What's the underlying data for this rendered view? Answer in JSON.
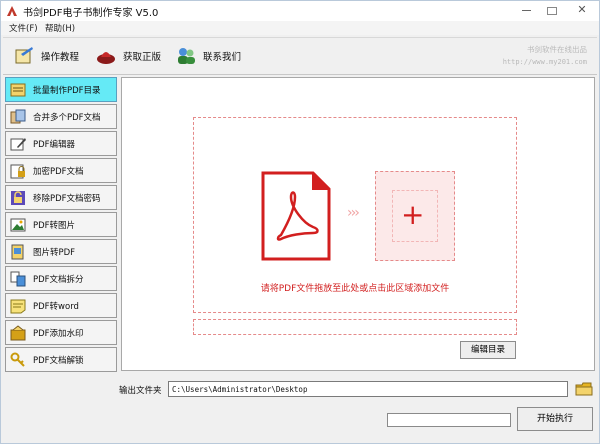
{
  "window": {
    "title": "书剑PDF电子书制作专家 V5.0"
  },
  "menu": {
    "file": "文件(F)",
    "help": "帮助(H)"
  },
  "toolbar": {
    "guide_label": "操作教程",
    "license_label": "获取正版",
    "contact_label": "联系我们",
    "brand_name": "书剑软件在线出品",
    "brand_url": "http://www.my201.com"
  },
  "sidebar": {
    "items": [
      {
        "label": "批量制作PDF目录",
        "icon": "folder-list-icon",
        "active": true
      },
      {
        "label": "合并多个PDF文档",
        "icon": "merge-icon",
        "active": false
      },
      {
        "label": "PDF编辑器",
        "icon": "edit-icon",
        "active": false
      },
      {
        "label": "加密PDF文档",
        "icon": "encrypt-icon",
        "active": false
      },
      {
        "label": "移除PDF文档密码",
        "icon": "unlock-icon",
        "active": false
      },
      {
        "label": "PDF转图片",
        "icon": "pdf-to-image-icon",
        "active": false
      },
      {
        "label": "图片转PDF",
        "icon": "image-to-pdf-icon",
        "active": false
      },
      {
        "label": "PDF文档拆分",
        "icon": "split-icon",
        "active": false
      },
      {
        "label": "PDF转word",
        "icon": "word-icon",
        "active": false
      },
      {
        "label": "PDF添加水印",
        "icon": "watermark-icon",
        "active": false
      },
      {
        "label": "PDF文档解锁",
        "icon": "keys-icon",
        "active": false
      }
    ]
  },
  "dropzone": {
    "hint": "请将PDF文件拖放至此处或点击此区域添加文件",
    "plus": "+",
    "arrows": "›››"
  },
  "actions": {
    "edit_toc": "编辑目录",
    "start": "开始执行"
  },
  "output": {
    "label": "输出文件夹",
    "path": "C:\\Users\\Administrator\\Desktop"
  },
  "progress": {
    "fraction": 0
  },
  "colors": {
    "accent_red": "#d21f1f",
    "active_nav": "#65eaf6"
  }
}
